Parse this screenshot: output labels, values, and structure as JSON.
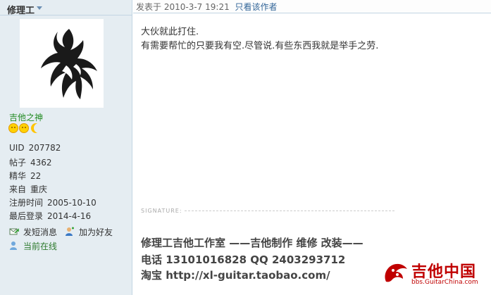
{
  "profile": {
    "username": "修理工",
    "rank": "吉他之神",
    "stats": [
      {
        "key": "UID",
        "value": "207782"
      },
      {
        "key": "帖子",
        "value": "4362"
      },
      {
        "key": "精华",
        "value": "22"
      },
      {
        "key": "来自",
        "value": "重庆"
      },
      {
        "key": "注册时间",
        "value": "2005-10-10"
      },
      {
        "key": "最后登录",
        "value": "2014-4-16"
      }
    ],
    "actions": {
      "message": "发短消息",
      "add_friend": "加为好友",
      "online": "当前在线"
    }
  },
  "post": {
    "posted_prefix": "发表于",
    "posted_at": "2010-3-7 19:21",
    "only_author": "只看该作者",
    "lines": [
      "大伙就此打住.",
      "有需要帮忙的只要我有空.尽管说.有些东西我就是举手之劳."
    ]
  },
  "signature": {
    "label": "SIGNATURE:",
    "line1": "修理工吉他工作室  ——吉他制作  维修  改装——",
    "line2": "电话  13101016828 QQ 2403293712",
    "line3": "淘宝  http://xl-guitar.taobao.com/"
  },
  "watermark": {
    "name": "吉他中国",
    "url": "bbs.GuitarChina.com"
  },
  "colors": {
    "sidebar_bg": "#e5edf2",
    "border": "#c2d5e3",
    "link": "#336699",
    "rank": "#228b22",
    "watermark": "#c00000"
  }
}
